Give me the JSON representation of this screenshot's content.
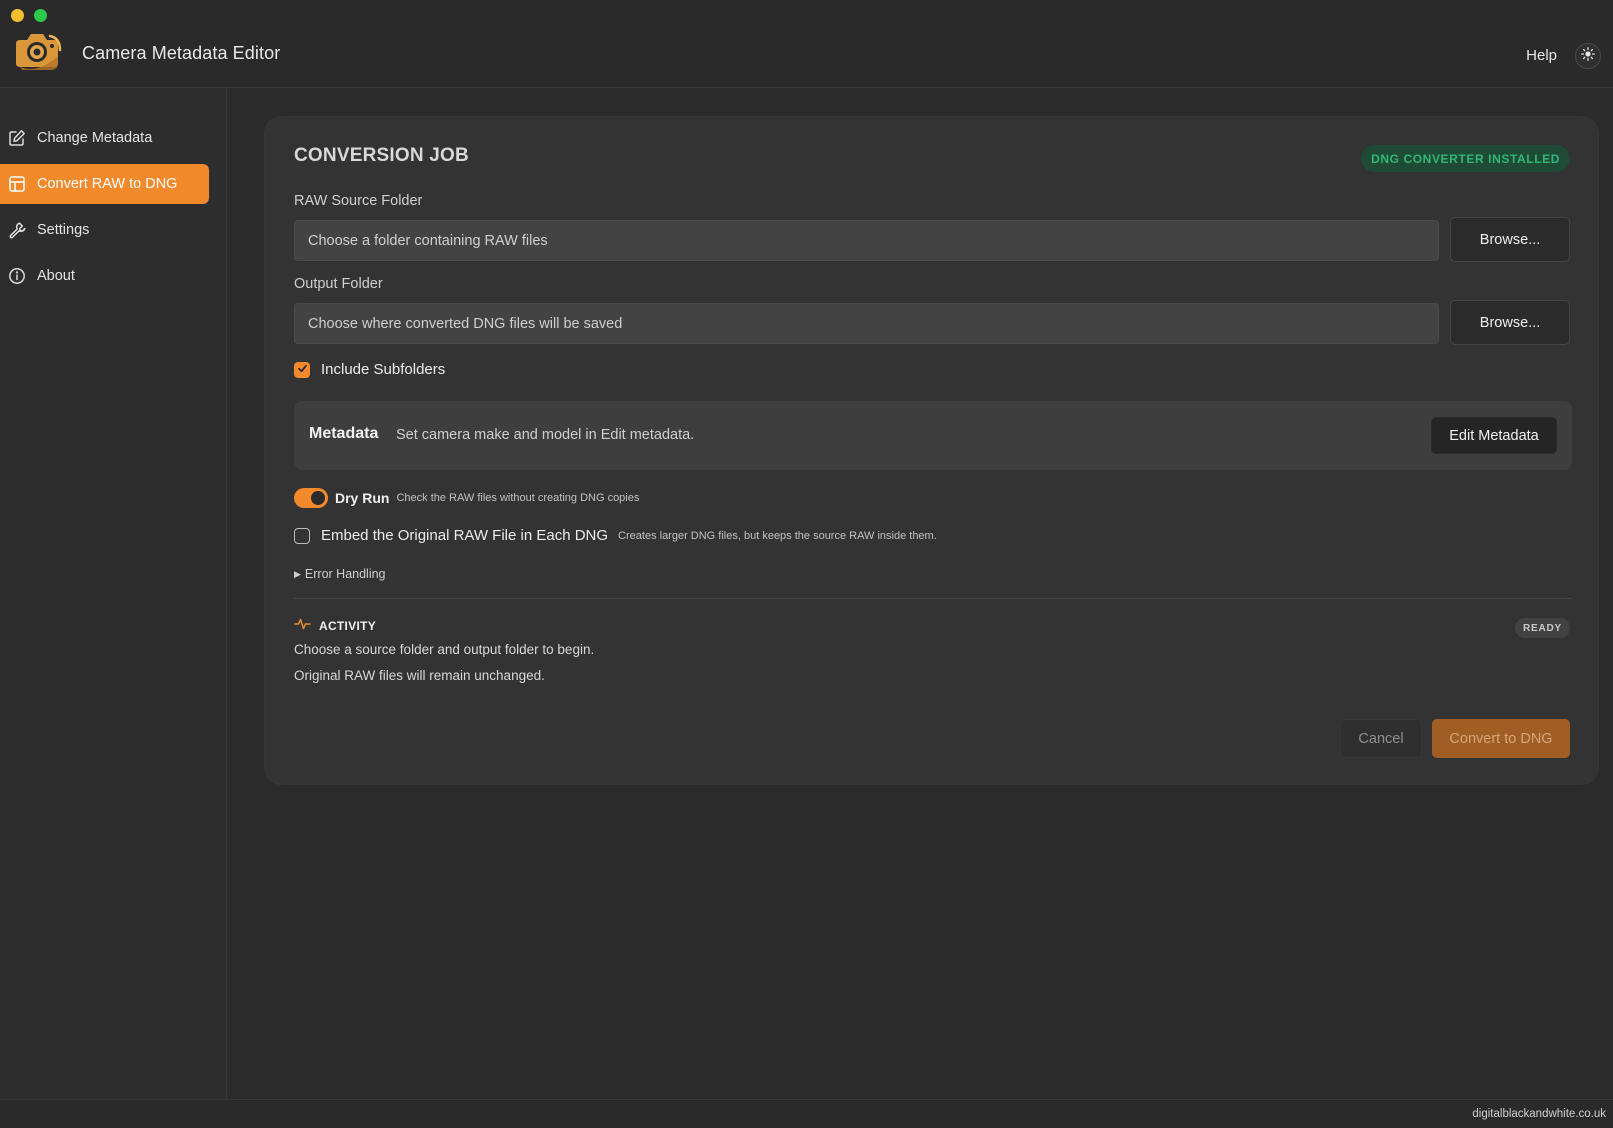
{
  "app": {
    "title": "Camera Metadata Editor",
    "help_label": "Help",
    "theme_icon": "sun-icon"
  },
  "sidebar": {
    "items": [
      {
        "label": "Change Metadata",
        "icon": "edit-icon",
        "active": false
      },
      {
        "label": "Convert RAW to DNG",
        "icon": "table-icon",
        "active": true
      },
      {
        "label": "Settings",
        "icon": "wrench-icon",
        "active": false
      },
      {
        "label": "About",
        "icon": "info-icon",
        "active": false
      }
    ]
  },
  "job": {
    "title": "CONVERSION JOB",
    "status": "DNG CONVERTER INSTALLED",
    "raw_source": {
      "label": "RAW Source Folder",
      "placeholder": "Choose a folder containing RAW files",
      "value": "",
      "browse_label": "Browse..."
    },
    "output": {
      "label": "Output Folder",
      "placeholder": "Choose where converted DNG files will be saved",
      "value": "",
      "browse_label": "Browse..."
    },
    "include_subfolders": {
      "label": "Include Subfolders",
      "checked": true
    },
    "metadata": {
      "title": "Metadata",
      "description": "Set camera make and model in Edit metadata.",
      "button_label": "Edit Metadata"
    },
    "dry_run": {
      "label": "Dry Run",
      "hint": "Check the RAW files without creating DNG copies",
      "on": true
    },
    "embed_raw": {
      "label": "Embed the Original RAW File in Each DNG",
      "hint": "Creates larger DNG files, but keeps the source RAW inside them.",
      "checked": false
    },
    "error_handling_label": "Error Handling"
  },
  "activity": {
    "title": "ACTIVITY",
    "status": "READY",
    "lines": [
      "Choose a source folder and output folder to begin.",
      "Original RAW files will remain unchanged."
    ]
  },
  "actions": {
    "cancel_label": "Cancel",
    "convert_label": "Convert to DNG"
  },
  "footer": {
    "link": "digitalblackandwhite.co.uk"
  },
  "colors": {
    "accent": "#f28a2c",
    "background": "#2b2b2b",
    "card": "#333333",
    "status_green": "#2fb877"
  }
}
